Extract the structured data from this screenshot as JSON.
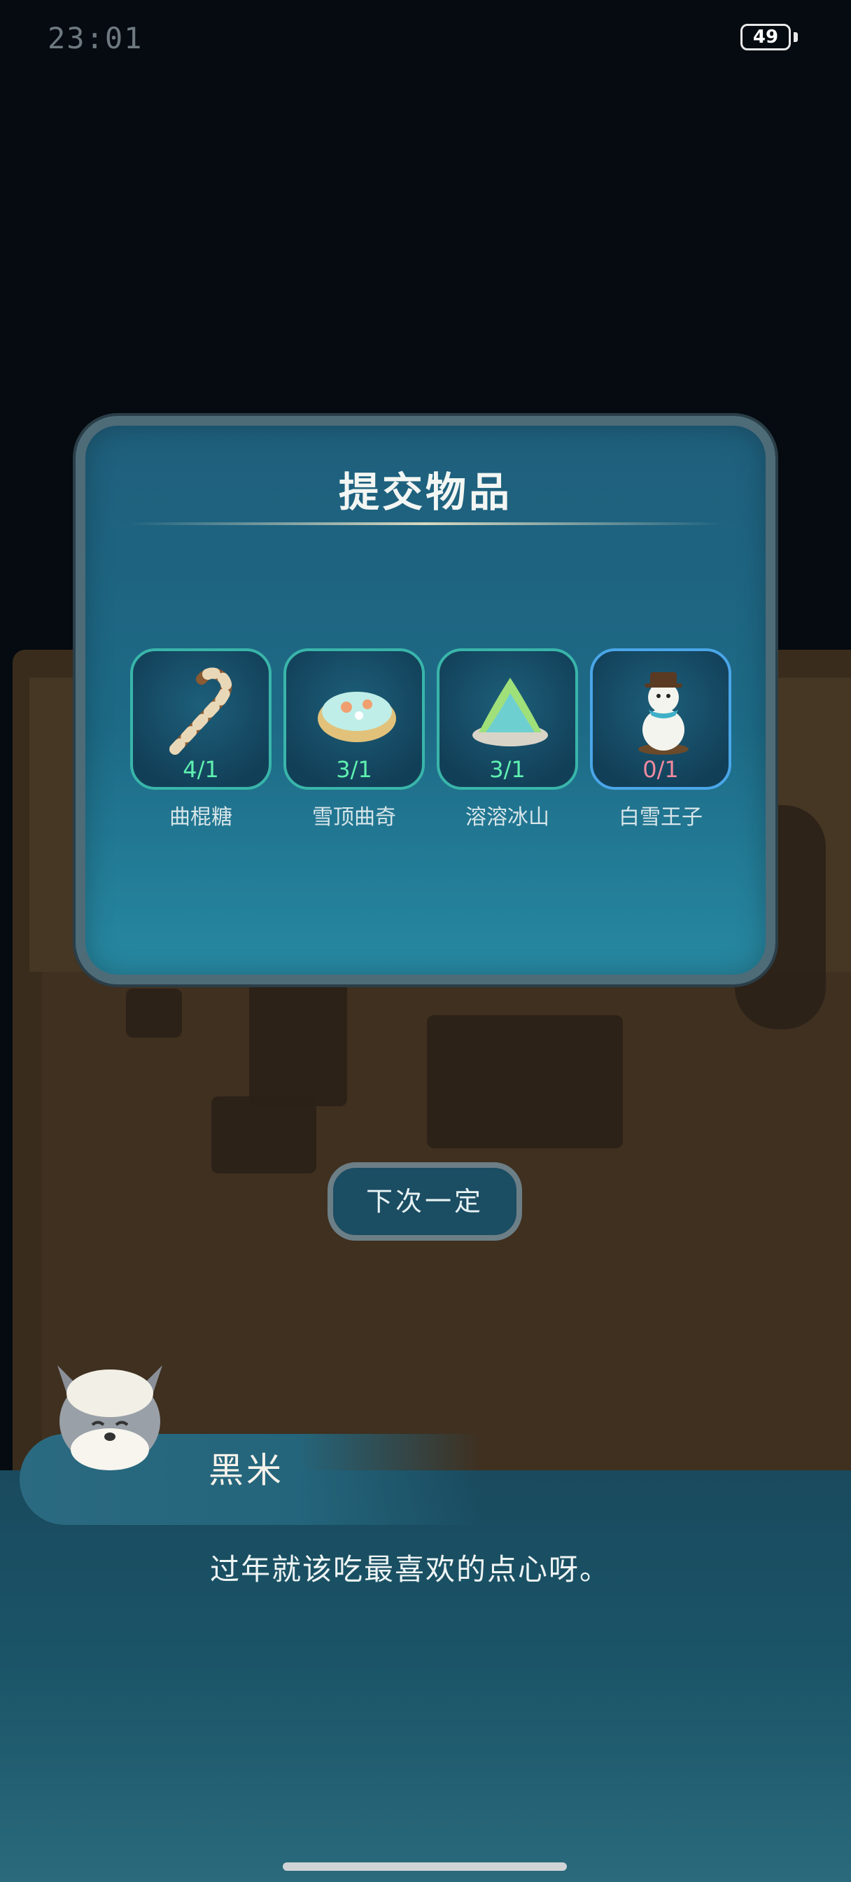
{
  "status_bar": {
    "time": "23:01",
    "battery": "49"
  },
  "dialog": {
    "title": "提交物品",
    "items": [
      {
        "name": "曲棍糖",
        "count": "4/1",
        "icon": "candy-cane-icon",
        "enough": true
      },
      {
        "name": "雪顶曲奇",
        "count": "3/1",
        "icon": "snow-cookie-icon",
        "enough": true
      },
      {
        "name": "溶溶冰山",
        "count": "3/1",
        "icon": "ice-mountain-icon",
        "enough": true
      },
      {
        "name": "白雪王子",
        "count": "0/1",
        "icon": "snowman-icon",
        "enough": false
      }
    ]
  },
  "button": {
    "label": "下次一定"
  },
  "speech": {
    "speaker": "黑米",
    "text": "过年就该吃最喜欢的点心呀。"
  },
  "colors": {
    "enough_count": "#5ff0b0",
    "missing_count": "#f08aa0",
    "dialog_bg": "#1f5f7c"
  }
}
